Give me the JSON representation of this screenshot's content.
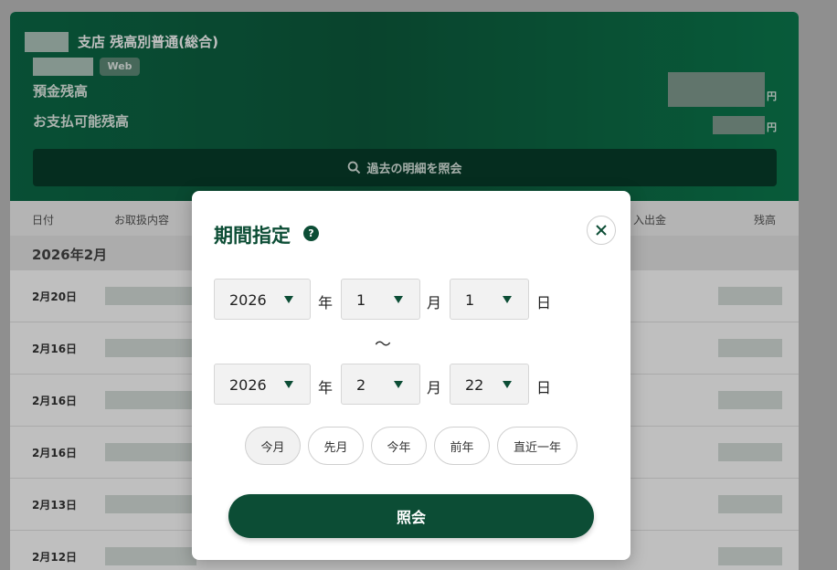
{
  "account": {
    "title": "支店 残高別普通(総合)",
    "badge": "Web",
    "deposit_label": "預金残高",
    "payable_label": "お支払可能残高",
    "yen_unit": "円",
    "history_button": "過去の明細を照会"
  },
  "table": {
    "columns": [
      "日付",
      "お取扱内容",
      "入出金",
      "残高"
    ],
    "month": "2026年2月",
    "rows": [
      {
        "date": "2月20日"
      },
      {
        "date": "2月16日"
      },
      {
        "date": "2月16日"
      },
      {
        "date": "2月16日"
      },
      {
        "date": "2月13日"
      },
      {
        "date": "2月12日"
      }
    ]
  },
  "modal": {
    "title": "期間指定",
    "help_icon": "question-icon",
    "close_icon": "close-icon",
    "from": {
      "year": "2026",
      "month": "1",
      "day": "1"
    },
    "to": {
      "year": "2026",
      "month": "2",
      "day": "22"
    },
    "units": {
      "year": "年",
      "month": "月",
      "day": "日"
    },
    "range_separator": "～",
    "quick_buttons": [
      "今月",
      "先月",
      "今年",
      "前年",
      "直近一年"
    ],
    "active_quick": "今月",
    "submit_label": "照会"
  },
  "colors": {
    "brand_green": "#0c4d35",
    "header_green": "#0b6a47"
  }
}
